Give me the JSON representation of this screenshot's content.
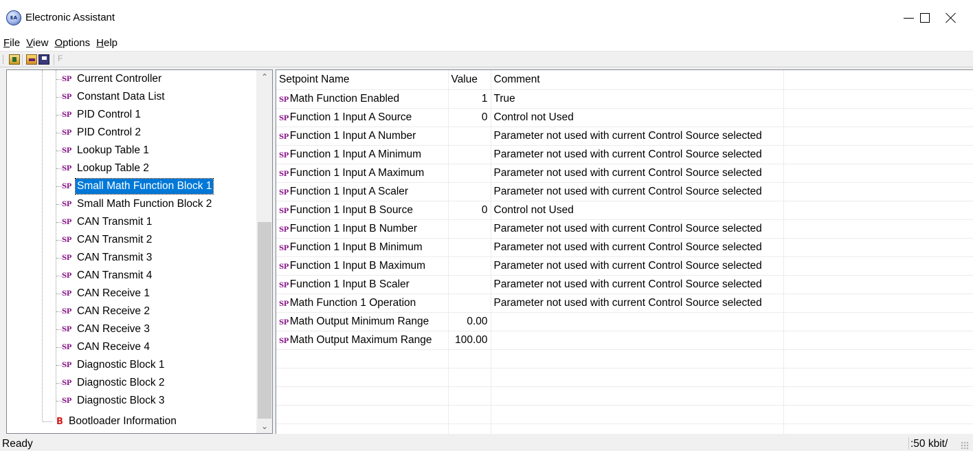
{
  "window": {
    "title": "Electronic Assistant",
    "app_icon_text": "EA"
  },
  "menu": [
    {
      "hot": "F",
      "rest": "ile"
    },
    {
      "hot": "V",
      "rest": "iew"
    },
    {
      "hot": "O",
      "rest": "ptions"
    },
    {
      "hot": "H",
      "rest": "elp"
    }
  ],
  "toolbar": {
    "disabled_button_label": "F"
  },
  "tree": {
    "sp_icon": "SP",
    "items": [
      "Current Controller",
      "Constant Data List",
      "PID Control 1",
      "PID Control 2",
      "Lookup Table 1",
      "Lookup Table 2",
      "Small Math Function Block 1",
      "Small Math Function Block 2",
      "CAN Transmit 1",
      "CAN Transmit 2",
      "CAN Transmit 3",
      "CAN Transmit 4",
      "CAN Receive 1",
      "CAN Receive 2",
      "CAN Receive 3",
      "CAN Receive 4",
      "Diagnostic Block 1",
      "Diagnostic Block 2",
      "Diagnostic Block 3"
    ],
    "selected_index": 6,
    "bootloader": {
      "icon": "B",
      "label": "Bootloader Information"
    }
  },
  "grid": {
    "headers": {
      "name": "Setpoint Name",
      "value": "Value",
      "comment": "Comment"
    },
    "row_icon": "SP",
    "rows": [
      {
        "name": "Math Function Enabled",
        "value": "1",
        "comment": "True"
      },
      {
        "name": "Function 1 Input A Source",
        "value": "0",
        "comment": "Control not Used"
      },
      {
        "name": "Function 1 Input A Number",
        "value": "",
        "comment": "Parameter not used with current Control Source selected"
      },
      {
        "name": "Function 1 Input A Minimum",
        "value": "",
        "comment": "Parameter not used with current Control Source selected"
      },
      {
        "name": "Function 1 Input A Maximum",
        "value": "",
        "comment": "Parameter not used with current Control Source selected"
      },
      {
        "name": "Function 1 Input A Scaler",
        "value": "",
        "comment": "Parameter not used with current Control Source selected"
      },
      {
        "name": "Function 1 Input B Source",
        "value": "0",
        "comment": "Control not Used"
      },
      {
        "name": "Function 1 Input B Number",
        "value": "",
        "comment": "Parameter not used with current Control Source selected"
      },
      {
        "name": "Function 1 Input B Minimum",
        "value": "",
        "comment": "Parameter not used with current Control Source selected"
      },
      {
        "name": "Function 1 Input B Maximum",
        "value": "",
        "comment": "Parameter not used with current Control Source selected"
      },
      {
        "name": "Function 1 Input B Scaler",
        "value": "",
        "comment": "Parameter not used with current Control Source selected"
      },
      {
        "name": "Math Function 1 Operation",
        "value": "",
        "comment": "Parameter not used with current Control Source selected"
      },
      {
        "name": "Math Output Minimum Range",
        "value": "0.00",
        "comment": ""
      },
      {
        "name": "Math Output Maximum Range",
        "value": "100.00",
        "comment": ""
      }
    ],
    "empty_rows": 5
  },
  "status": {
    "left": "Ready",
    "right": ":50 kbit/"
  },
  "colors": {
    "selection": "#0078d7",
    "sp_icon": "#8b1a8b",
    "b_icon": "#d01c1c"
  }
}
